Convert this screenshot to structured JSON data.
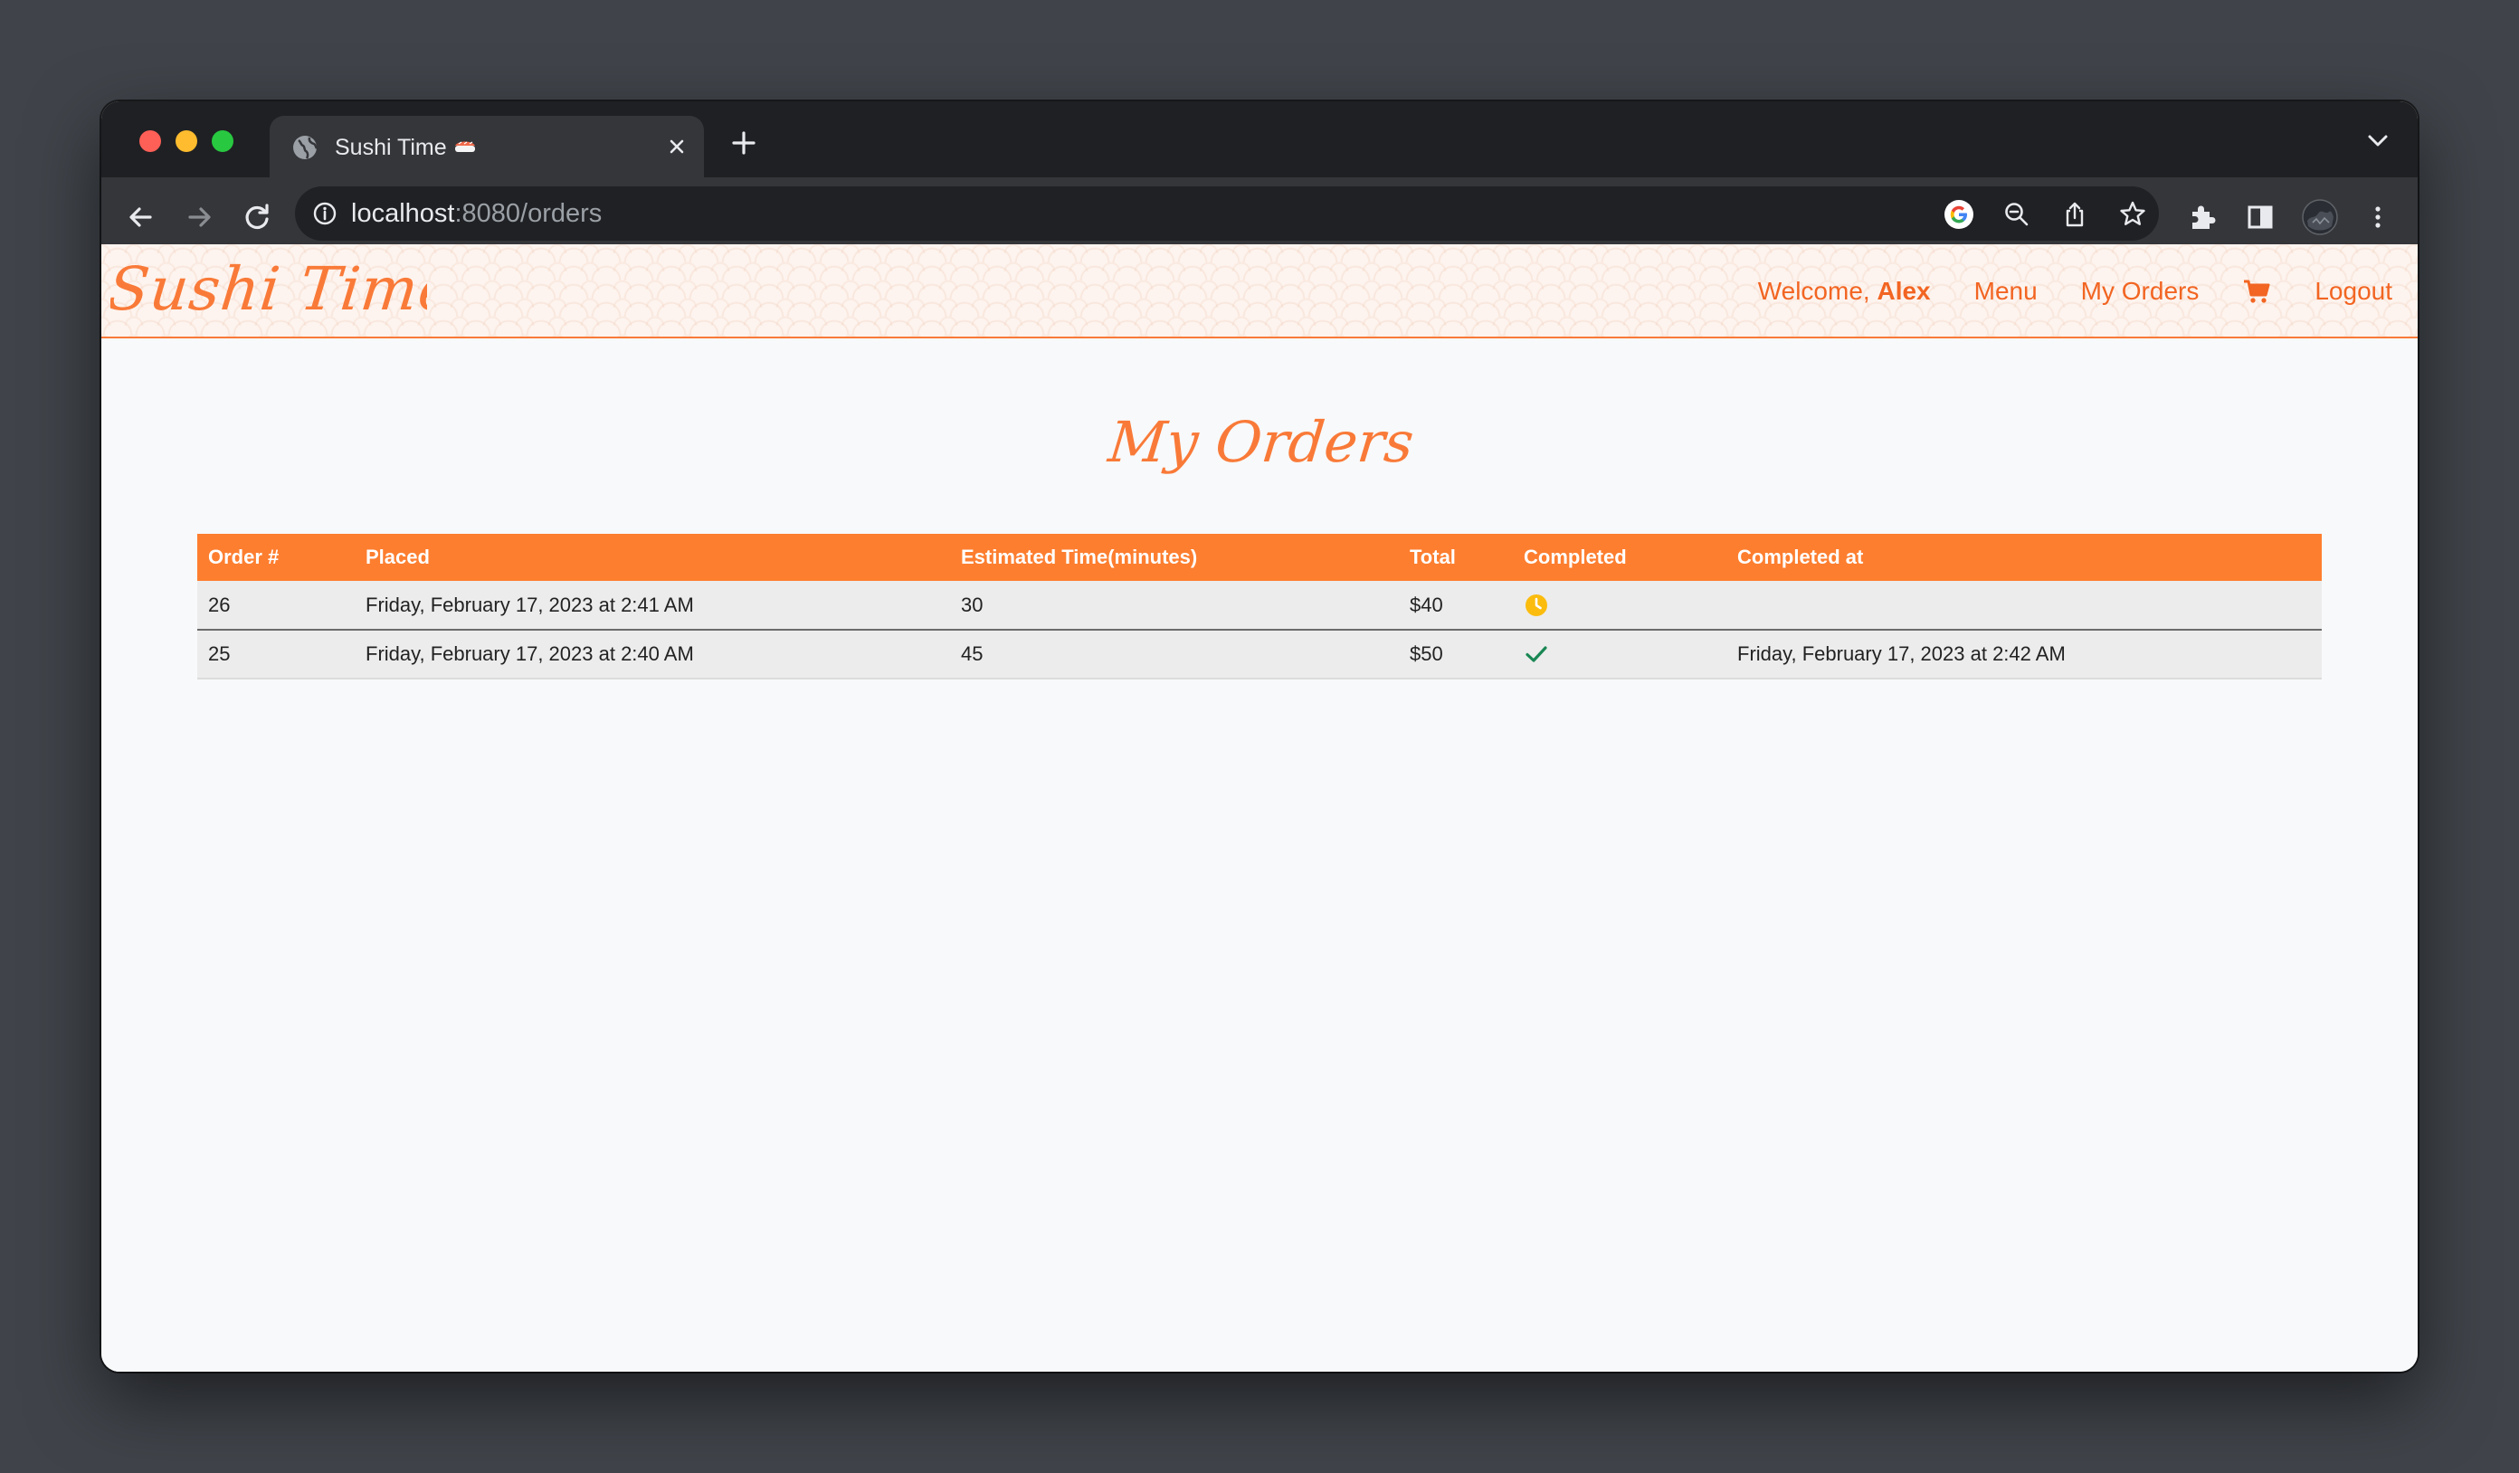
{
  "browser": {
    "tab": {
      "title": "Sushi Time",
      "favicon": "globe-icon",
      "emoji": "sushi-emoji-icon",
      "close": "close-icon"
    },
    "new_tab": "plus-icon",
    "tab_search": "chevron-down-icon",
    "nav": {
      "back": "back-arrow-icon",
      "forward": "forward-arrow-icon",
      "reload": "reload-icon"
    },
    "address": {
      "host": "localhost",
      "rest": ":8080/orders",
      "info": "info-icon"
    },
    "address_icons": [
      "google-icon",
      "zoom-out-icon",
      "share-icon",
      "bookmark-star-icon"
    ],
    "toolbar_icons": [
      "extensions-icon",
      "side-panel-icon",
      "profile-avatar",
      "kebab-menu-icon"
    ]
  },
  "site": {
    "brand": "Sushi Time",
    "nav": {
      "welcome_prefix": "Welcome, ",
      "welcome_name": "Alex",
      "menu": "Menu",
      "my_orders": "My Orders",
      "cart": "cart-icon",
      "logout": "Logout"
    },
    "accent": "#f26522",
    "header_orange": "#fd7e2f"
  },
  "page": {
    "heading": "My Orders"
  },
  "orders": {
    "columns": [
      "Order #",
      "Placed",
      "Estimated Time(minutes)",
      "Total",
      "Completed",
      "Completed at"
    ],
    "rows": [
      {
        "order": "26",
        "placed": "Friday, February 17, 2023 at 2:41 AM",
        "estimate": "30",
        "total": "$40",
        "completed": "pending-clock-icon",
        "completed_at": ""
      },
      {
        "order": "25",
        "placed": "Friday, February 17, 2023 at 2:40 AM",
        "estimate": "45",
        "total": "$50",
        "completed": "checkmark-icon",
        "completed_at": "Friday, February 17, 2023 at 2:42 AM"
      }
    ]
  }
}
